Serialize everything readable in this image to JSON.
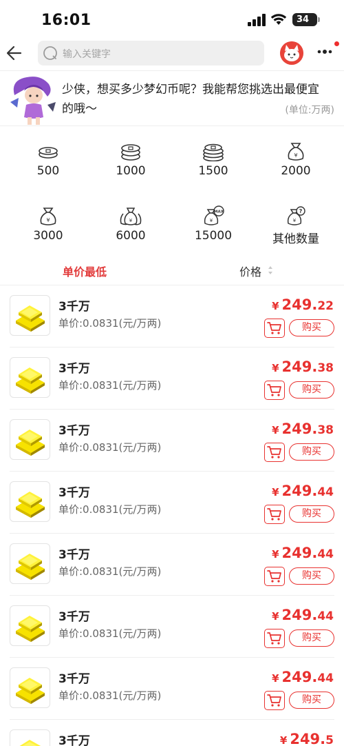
{
  "status_bar": {
    "time": "16:01",
    "battery": "34"
  },
  "header": {
    "search_placeholder": "输入关键字"
  },
  "intro": {
    "text": "少侠，想买多少梦幻币呢？我能帮您挑选出最便宜的哦～",
    "unit": "(单位:万两)"
  },
  "quantities": [
    {
      "label": "500",
      "icon": "coins-small-icon"
    },
    {
      "label": "1000",
      "icon": "coins-stack-icon"
    },
    {
      "label": "1500",
      "icon": "coins-stack-large-icon"
    },
    {
      "label": "2000",
      "icon": "money-bag-icon"
    },
    {
      "label": "3000",
      "icon": "money-bag-icon"
    },
    {
      "label": "6000",
      "icon": "money-bags-icon"
    },
    {
      "label": "15000",
      "icon": "money-bag-max-icon"
    },
    {
      "label": "其他数量",
      "icon": "money-bag-question-icon"
    }
  ],
  "sort": {
    "unit_price_low": "单价最低",
    "price": "价格"
  },
  "items": [
    {
      "title": "3千万",
      "unit_price": "单价:0.0831(元/万两)",
      "currency": "¥",
      "price_int": "249.",
      "price_dec": "22",
      "buy": "购买"
    },
    {
      "title": "3千万",
      "unit_price": "单价:0.0831(元/万两)",
      "currency": "¥",
      "price_int": "249.",
      "price_dec": "38",
      "buy": "购买"
    },
    {
      "title": "3千万",
      "unit_price": "单价:0.0831(元/万两)",
      "currency": "¥",
      "price_int": "249.",
      "price_dec": "38",
      "buy": "购买"
    },
    {
      "title": "3千万",
      "unit_price": "单价:0.0831(元/万两)",
      "currency": "¥",
      "price_int": "249.",
      "price_dec": "44",
      "buy": "购买"
    },
    {
      "title": "3千万",
      "unit_price": "单价:0.0831(元/万两)",
      "currency": "¥",
      "price_int": "249.",
      "price_dec": "44",
      "buy": "购买"
    },
    {
      "title": "3千万",
      "unit_price": "单价:0.0831(元/万两)",
      "currency": "¥",
      "price_int": "249.",
      "price_dec": "44",
      "buy": "购买"
    },
    {
      "title": "3千万",
      "unit_price": "单价:0.0831(元/万两)",
      "currency": "¥",
      "price_int": "249.",
      "price_dec": "44",
      "buy": "购买"
    },
    {
      "title": "3千万",
      "unit_price": "",
      "currency": "¥",
      "price_int": "249.",
      "price_dec": "5",
      "buy": ""
    }
  ],
  "colors": {
    "accent": "#e8312f",
    "sort_active": "#e23c3c",
    "search_bg": "#efefef"
  }
}
